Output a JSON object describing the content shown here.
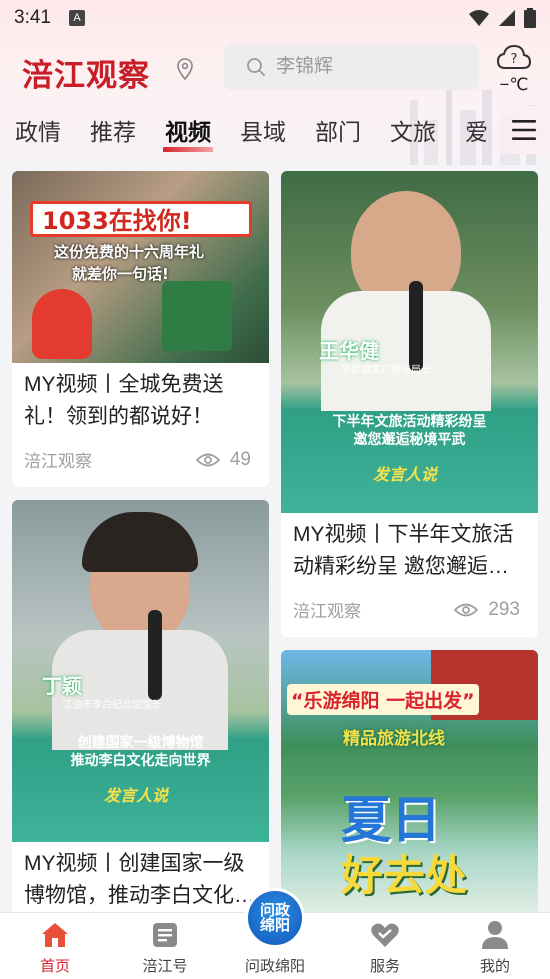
{
  "status_bar": {
    "time": "3:41",
    "a_label": "A"
  },
  "header": {
    "logo": "涪江观察",
    "search_placeholder": "李锦辉",
    "weather_temp": "−℃",
    "weather_icon": "cloud-question-icon"
  },
  "nav": {
    "tabs": [
      "政情",
      "推荐",
      "视频",
      "县域",
      "部门",
      "文旅",
      "爱"
    ],
    "active_tab": "视频"
  },
  "cards": [
    {
      "thumb_lines": [
        "1033在找你!",
        "这份免费的十六周年礼",
        "就差你一句话!"
      ],
      "title": "MY视频丨全城免费送礼！领到的都说好！",
      "source": "涪江观察",
      "views": "49"
    },
    {
      "thumb_lines": [
        "王华健",
        "平武县文广旅局局长",
        "下半年文旅活动精彩纷呈",
        "邀您邂逅秘境平武",
        "发言人说"
      ],
      "title": "MY视频丨下半年文旅活动精彩纷呈  邀您邂逅秘境平武",
      "source": "涪江观察",
      "views": "293"
    },
    {
      "thumb_lines": [
        "丁颖",
        "江油市李白纪念馆馆长",
        "创建国家一级博物馆",
        "推动李白文化走向世界",
        "发言人说"
      ],
      "title": "MY视频丨创建国家一级博物馆，推动李白文化走向世界"
    },
    {
      "thumb_lines": [
        "“乐游绵阳 一起出发”",
        "精品旅游北线",
        "夏日",
        "好去处"
      ]
    }
  ],
  "bottom_nav": {
    "items": [
      {
        "label": "首页",
        "icon": "home-icon"
      },
      {
        "label": "涪江号",
        "icon": "grid-icon"
      },
      {
        "label": "问政绵阳",
        "icon": "wenzheng-badge-icon"
      },
      {
        "label": "服务",
        "icon": "heart-icon"
      },
      {
        "label": "我的",
        "icon": "user-icon"
      }
    ],
    "center_badge": "问政\n绵阳"
  },
  "colors": {
    "brand_red": "#d9232e",
    "logo_red": "#c81e28",
    "gray_text": "#a0a0a0"
  }
}
